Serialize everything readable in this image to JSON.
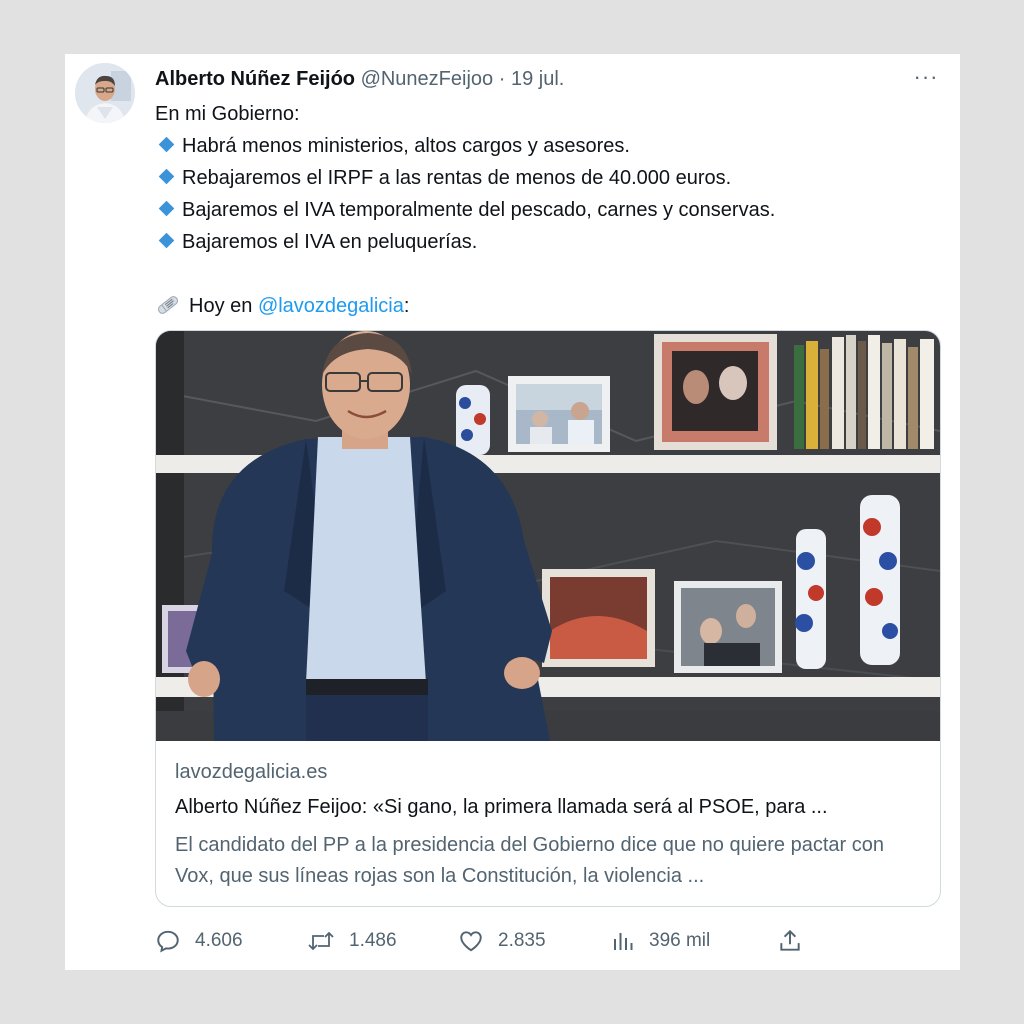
{
  "tweet": {
    "author_name": "Alberto Núñez Feijóo",
    "handle": "@NunezFeijoo",
    "separator": "·",
    "date": "19 jul.",
    "more_label": "···",
    "intro": "En mi Gobierno:",
    "bullets": [
      "Habrá menos ministerios, altos cargos y asesores.",
      "Rebajaremos el IRPF a las rentas de menos de 40.000 euros.",
      "Bajaremos el IVA temporalmente del pescado, carnes y conservas.",
      "Bajaremos el IVA en peluquerías."
    ],
    "bullet_icon": "small-blue-diamond-icon",
    "bullet_color": "#3b94d9",
    "news_prefix": "Hoy en",
    "news_mention": "@lavozdegalicia",
    "news_suffix": ":",
    "news_icon": "rolled-newspaper-icon",
    "mention_color": "#1d9bf0"
  },
  "link_card": {
    "domain": "lavozdegalicia.es",
    "title": "Alberto Núñez Feijoo: «Si gano, la primera llamada será al PSOE, para ...",
    "description": "El candidato del PP a la presidencia del Gobierno dice que no quiere pactar con Vox, que sus líneas rojas son la Constitución, la violencia ..."
  },
  "actions": {
    "replies": "4.606",
    "retweets": "1.486",
    "likes": "2.835",
    "views": "396 mil",
    "reply_icon": "reply-bubble-icon",
    "retweet_icon": "retweet-icon",
    "like_icon": "heart-icon",
    "views_icon": "analytics-bars-icon",
    "share_icon": "share-upload-icon"
  }
}
